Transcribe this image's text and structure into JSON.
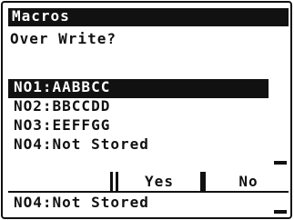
{
  "header": {
    "title": "Macros"
  },
  "dialog": {
    "prompt": "Over Write?"
  },
  "list": {
    "items": [
      {
        "label": "NO1:AABBCC",
        "selected": true
      },
      {
        "label": "NO2:BBCCDD",
        "selected": false
      },
      {
        "label": "NO3:EEFFGG",
        "selected": false
      },
      {
        "label": "NO4:Not Stored",
        "selected": false
      }
    ]
  },
  "buttons": {
    "blank": "",
    "yes": "Yes",
    "no": "No"
  },
  "footer": {
    "label": "NO4:Not Stored"
  },
  "colors": {
    "foreground": "#111111",
    "background": "#ffffff"
  }
}
